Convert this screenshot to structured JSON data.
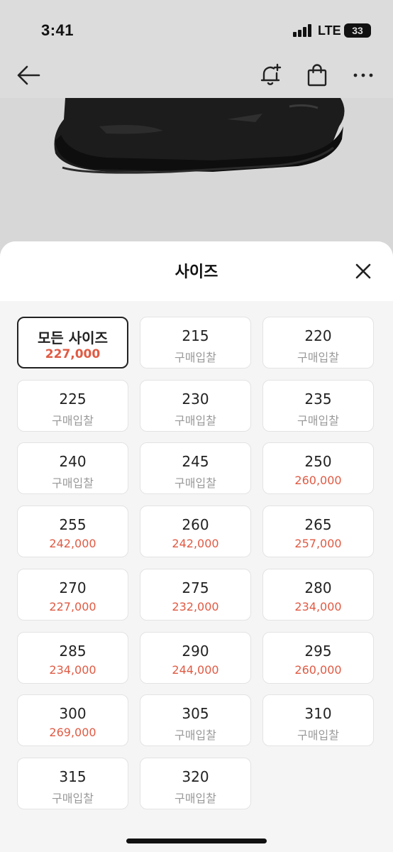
{
  "status": {
    "time": "3:41",
    "network": "LTE",
    "battery": "33"
  },
  "nav": {
    "back_icon": "arrow-left-icon",
    "alert_icon": "bell-plus-icon",
    "bag_icon": "shopping-bag-icon",
    "more_icon": "more-dots-icon"
  },
  "sheet": {
    "title": "사이즈",
    "close_icon": "close-icon"
  },
  "colors": {
    "price_red": "#e05a43",
    "muted_text": "#999999"
  },
  "sizes": [
    {
      "size": "모든 사이즈",
      "price": "227,000",
      "has_price": true,
      "selected": true
    },
    {
      "size": "215",
      "price": "구매입찰",
      "has_price": false
    },
    {
      "size": "220",
      "price": "구매입찰",
      "has_price": false
    },
    {
      "size": "225",
      "price": "구매입찰",
      "has_price": false
    },
    {
      "size": "230",
      "price": "구매입찰",
      "has_price": false
    },
    {
      "size": "235",
      "price": "구매입찰",
      "has_price": false
    },
    {
      "size": "240",
      "price": "구매입찰",
      "has_price": false
    },
    {
      "size": "245",
      "price": "구매입찰",
      "has_price": false
    },
    {
      "size": "250",
      "price": "260,000",
      "has_price": true
    },
    {
      "size": "255",
      "price": "242,000",
      "has_price": true
    },
    {
      "size": "260",
      "price": "242,000",
      "has_price": true
    },
    {
      "size": "265",
      "price": "257,000",
      "has_price": true
    },
    {
      "size": "270",
      "price": "227,000",
      "has_price": true
    },
    {
      "size": "275",
      "price": "232,000",
      "has_price": true
    },
    {
      "size": "280",
      "price": "234,000",
      "has_price": true
    },
    {
      "size": "285",
      "price": "234,000",
      "has_price": true
    },
    {
      "size": "290",
      "price": "244,000",
      "has_price": true
    },
    {
      "size": "295",
      "price": "260,000",
      "has_price": true
    },
    {
      "size": "300",
      "price": "269,000",
      "has_price": true
    },
    {
      "size": "305",
      "price": "구매입찰",
      "has_price": false
    },
    {
      "size": "310",
      "price": "구매입찰",
      "has_price": false
    },
    {
      "size": "315",
      "price": "구매입찰",
      "has_price": false
    },
    {
      "size": "320",
      "price": "구매입찰",
      "has_price": false
    }
  ]
}
